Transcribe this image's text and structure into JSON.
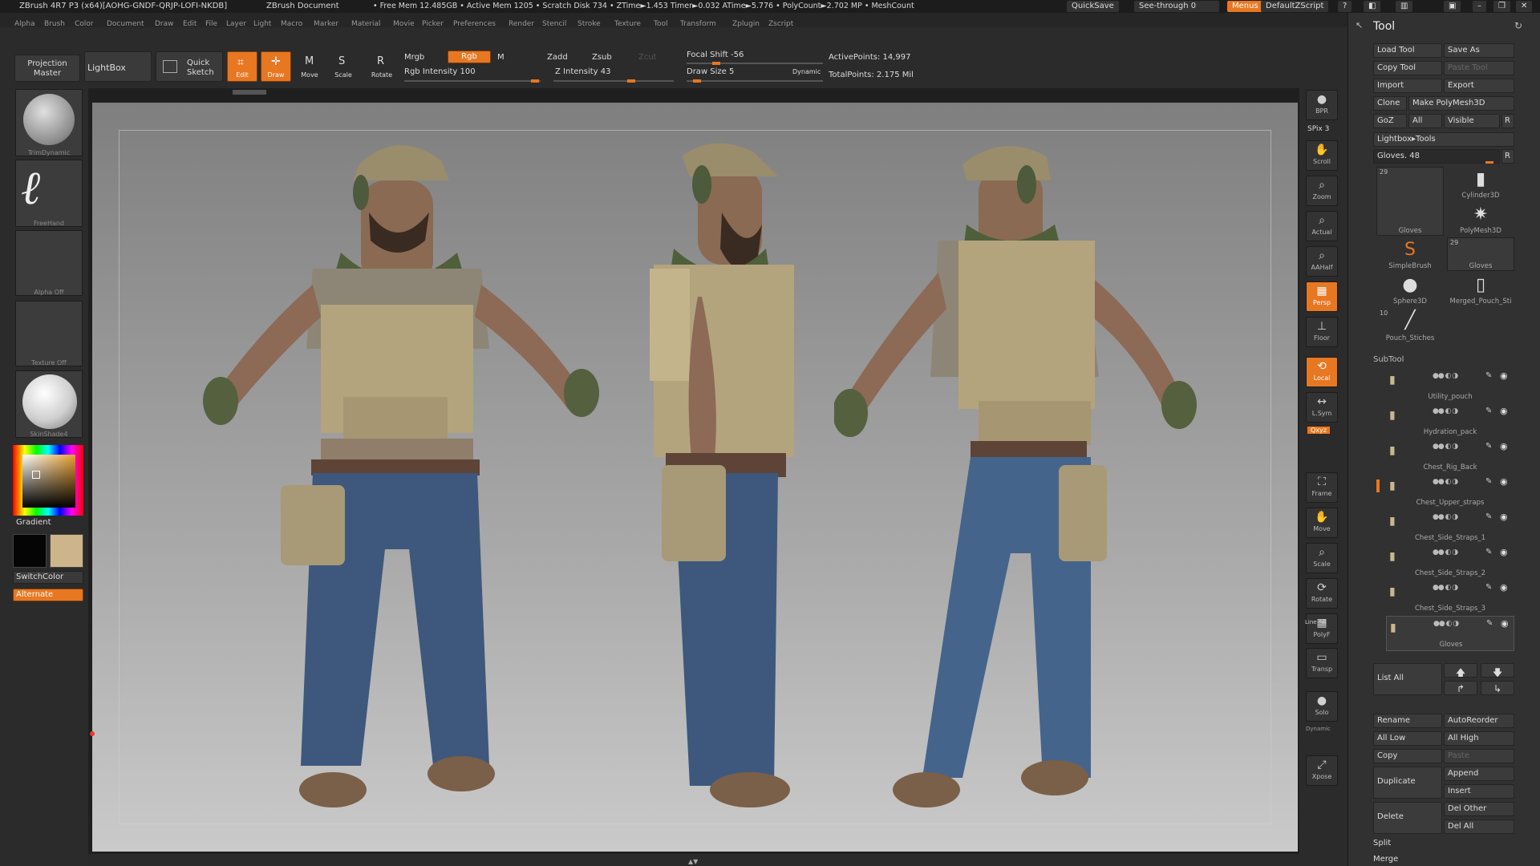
{
  "titlebar": {
    "app": "ZBrush 4R7 P3 (x64)[AOHG-GNDF-QRJP-LOFI-NKDB]",
    "document": "ZBrush Document",
    "stats": "• Free Mem 12.485GB • Active Mem 1205 • Scratch Disk 734 •   ZTime►1.453 Timer►0.032 ATime►5.776 • PolyCount►2.702 MP • MeshCount",
    "quicksave": "QuickSave",
    "seethrough": "See-through  0",
    "menus": "Menus",
    "script": "DefaultZScript"
  },
  "menubar": [
    "Alpha",
    "Brush",
    "Color",
    "Document",
    "Draw",
    "Edit",
    "File",
    "Layer",
    "Light",
    "Macro",
    "Marker",
    "Material",
    "Movie",
    "Picker",
    "Preferences",
    "Render",
    "Stencil",
    "Stroke",
    "Texture",
    "Tool",
    "Transform",
    "Zplugin",
    "Zscript"
  ],
  "topshelf": {
    "projection_master": "Projection Master",
    "lightbox": "LightBox",
    "quick_sketch": "Quick Sketch",
    "edit": "Edit",
    "draw": "Draw",
    "move": "Move",
    "scale": "Scale",
    "rotate": "Rotate",
    "mrgb": "Mrgb",
    "rgb": "Rgb",
    "m": "M",
    "rgb_intensity": "Rgb Intensity 100",
    "zadd": "Zadd",
    "zsub": "Zsub",
    "zcut": "Zcut",
    "z_intensity": "Z Intensity 43",
    "focal_shift": "Focal Shift -56",
    "draw_size": "Draw Size 5",
    "dynamic": "Dynamic",
    "active_points": "ActivePoints: 14,997",
    "total_points": "TotalPoints: 2.175 Mil"
  },
  "leftshelf": {
    "brush": "TrimDynamic",
    "stroke": "FreeHand",
    "alpha": "Alpha  Off",
    "texture": "Texture  Off",
    "material": "SkinShade4",
    "gradient": "Gradient",
    "switchcolor": "SwitchColor",
    "alternate": "Alternate"
  },
  "rightshelf": [
    {
      "label": "BPR",
      "icon": "●"
    },
    {
      "label": "Scroll",
      "icon": "✋"
    },
    {
      "label": "Zoom",
      "icon": "⌕"
    },
    {
      "label": "Actual",
      "icon": "⌕"
    },
    {
      "label": "AAHalf",
      "icon": "⌕"
    },
    {
      "label": "Persp",
      "icon": "▦",
      "on": true
    },
    {
      "label": "Floor",
      "icon": "⊥"
    },
    {
      "label": "Local",
      "icon": "⟲",
      "on": true
    },
    {
      "label": "L.Sym",
      "icon": "↔"
    },
    {
      "label": "Frame",
      "icon": "⛶"
    },
    {
      "label": "Move",
      "icon": "✋"
    },
    {
      "label": "Scale",
      "icon": "⌕"
    },
    {
      "label": "Rotate",
      "icon": "⟳"
    },
    {
      "label": "PolyF",
      "icon": "▦"
    },
    {
      "label": "Transp",
      "icon": "▭"
    },
    {
      "label": "Solo",
      "icon": "●"
    },
    {
      "label": "Xpose",
      "icon": "⤢"
    }
  ],
  "rightshelf_extra": {
    "spix": "SPix 3",
    "xyz": "Qxyz",
    "dynamic": "Dynamic",
    "linefill": "Line Fill"
  },
  "toolpanel": {
    "title": "Tool",
    "load_tool": "Load Tool",
    "save_as": "Save As",
    "copy_tool": "Copy Tool",
    "paste_tool": "Paste Tool",
    "import": "Import",
    "export": "Export",
    "clone": "Clone",
    "make_polymesh": "Make PolyMesh3D",
    "goz": "GoZ",
    "all": "All",
    "visible": "Visible",
    "r": "R",
    "lightbox_tools": "Lightbox▸Tools",
    "current": "Gloves. 48",
    "thumbs": [
      {
        "name": "Gloves",
        "count": "29"
      },
      {
        "name": "Cylinder3D"
      },
      {
        "name": "PolyMesh3D"
      },
      {
        "name": "SimpleBrush"
      },
      {
        "name": "Gloves",
        "count": "29"
      },
      {
        "name": "Sphere3D"
      },
      {
        "name": "Merged_Pouch_Sti"
      },
      {
        "name": "Pouch_Stiches",
        "count": "10"
      }
    ],
    "subtool_title": "SubTool",
    "subtools": [
      "Utility_pouch",
      "Hydration_pack",
      "Chest_Rig_Back",
      "Chest_Upper_straps",
      "Chest_Side_Straps_1",
      "Chest_Side_Straps_2",
      "Chest_Side_Straps_3",
      "Gloves"
    ],
    "list_all": "List All",
    "rename": "Rename",
    "autoreorder": "AutoReorder",
    "all_low": "All Low",
    "all_high": "All High",
    "copy": "Copy",
    "paste": "Paste",
    "duplicate": "Duplicate",
    "append": "Append",
    "insert": "Insert",
    "delete": "Delete",
    "del_other": "Del Other",
    "del_all": "Del All",
    "split": "Split",
    "merge": "Merge"
  },
  "colors": {
    "accent": "#e87722",
    "bg": "#2b2b2b",
    "canvas_top": "#7f7f7f",
    "canvas_bottom": "#cacaca"
  }
}
